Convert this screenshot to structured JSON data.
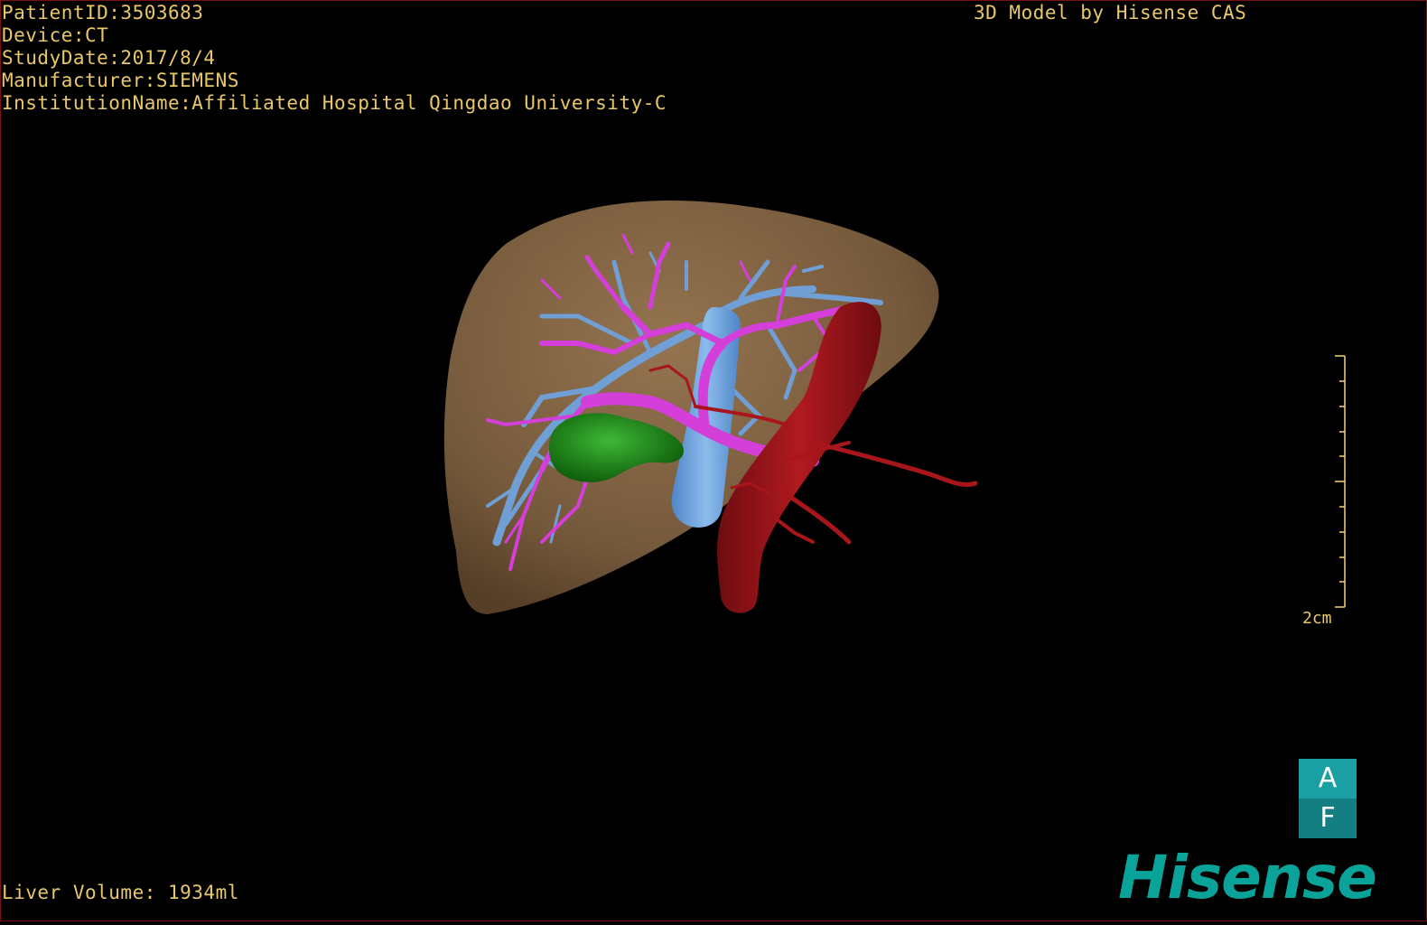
{
  "overlay": {
    "patient_id": "PatientID:3503683",
    "device": "Device:CT",
    "study_date": "StudyDate:2017/8/4",
    "manufacturer": "Manufacturer:SIEMENS",
    "institution": "InstitutionName:Affiliated Hospital Qingdao University-C",
    "credit": "3D Model by Hisense CAS",
    "liver_volume": "Liver Volume: 1934ml"
  },
  "scale_bar": {
    "label": "2cm"
  },
  "orientation_cube": {
    "top_label": "A",
    "bottom_label": "F"
  },
  "brand": {
    "logo_text": "Hisense"
  },
  "colors": {
    "overlay_text": "#e8c86a",
    "liver": "#8a6a48",
    "portal_vein": "#d33fd8",
    "hepatic_vein": "#6f9fd4",
    "artery": "#9a1418",
    "tumor": "#1f8a1a",
    "brand": "#0aa39a"
  }
}
